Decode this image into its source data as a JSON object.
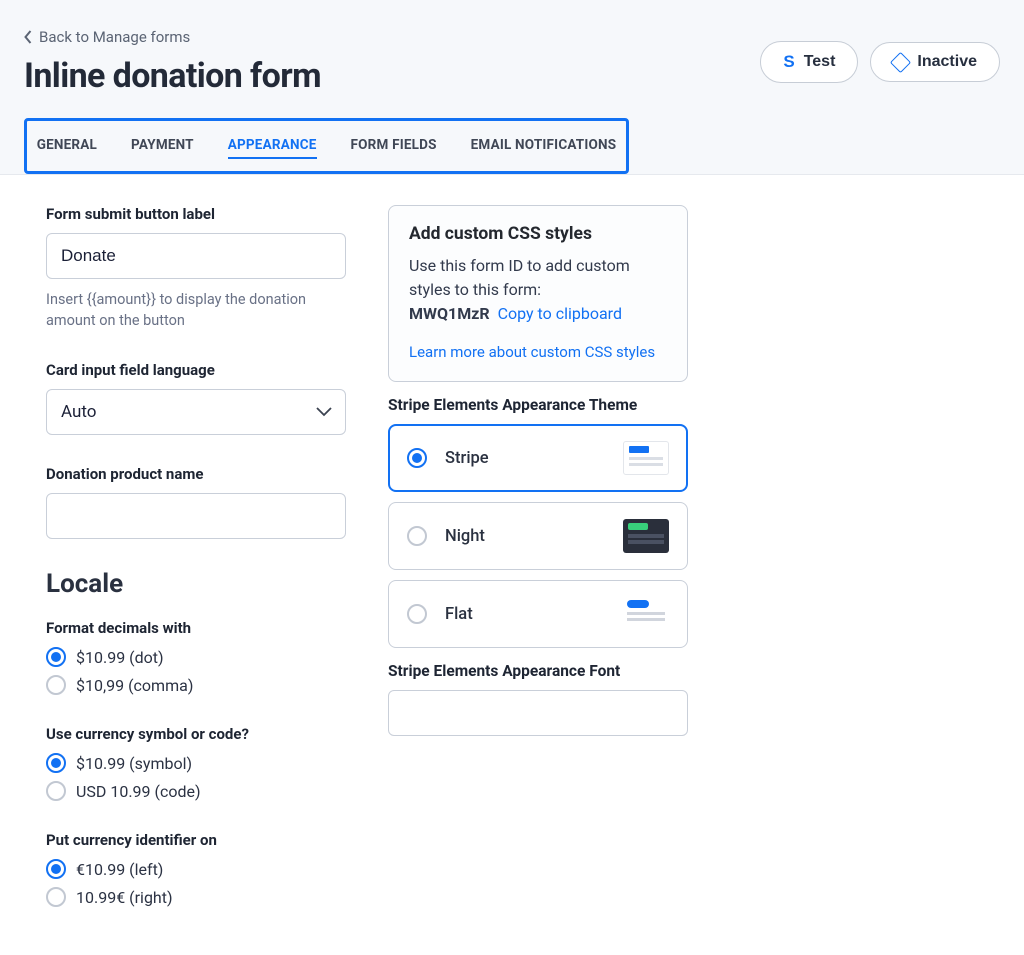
{
  "back_link": "Back to Manage forms",
  "page_title": "Inline donation form",
  "actions": {
    "test": "Test",
    "inactive": "Inactive"
  },
  "tabs": {
    "general": "GENERAL",
    "payment": "PAYMENT",
    "appearance": "APPEARANCE",
    "form_fields": "FORM FIELDS",
    "email_notifications": "EMAIL NOTIFICATIONS"
  },
  "left": {
    "submit_label": {
      "label": "Form submit button label",
      "value": "Donate",
      "helper": "Insert {{amount}} to display the donation amount on the button"
    },
    "card_lang": {
      "label": "Card input field language",
      "value": "Auto"
    },
    "product_name": {
      "label": "Donation product name",
      "value": ""
    },
    "locale_title": "Locale",
    "decimals": {
      "label": "Format decimals with",
      "dot": "$10.99 (dot)",
      "comma": "$10,99 (comma)"
    },
    "currency_symbol": {
      "label": "Use currency symbol or code?",
      "symbol": "$10.99 (symbol)",
      "code": "USD 10.99 (code)"
    },
    "currency_pos": {
      "label": "Put currency identifier on",
      "left": "€10.99 (left)",
      "right": "10.99€ (right)"
    }
  },
  "right": {
    "css_card": {
      "title": "Add custom CSS styles",
      "desc1": "Use this form ID to add custom styles to this form:",
      "form_id": "MWQ1MzR",
      "copy": "Copy to clipboard",
      "learn_more": "Learn more about custom CSS styles"
    },
    "theme": {
      "label": "Stripe Elements Appearance Theme",
      "stripe": "Stripe",
      "night": "Night",
      "flat": "Flat"
    },
    "font": {
      "label": "Stripe Elements Appearance Font",
      "value": ""
    }
  }
}
